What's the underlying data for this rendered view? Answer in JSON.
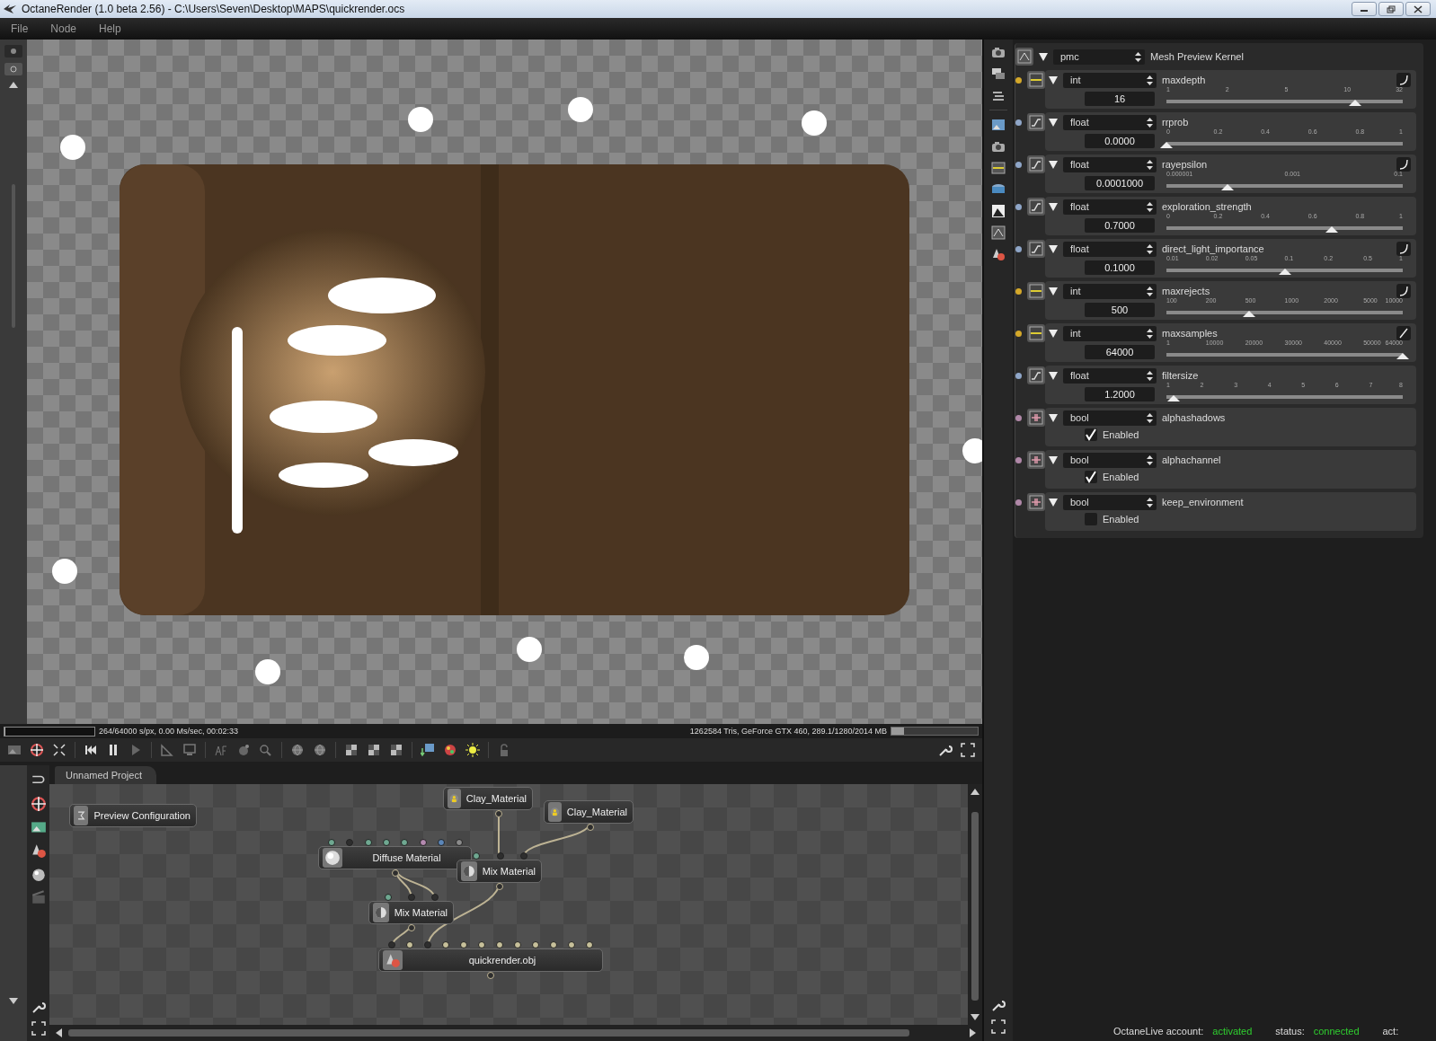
{
  "window": {
    "title": "OctaneRender (1.0 beta 2.56) - C:\\Users\\Seven\\Desktop\\MAPS\\quickrender.ocs"
  },
  "menu": [
    "File",
    "Node",
    "Help"
  ],
  "render_status": {
    "progress": {
      "level": 0.004
    },
    "stats": "264/64000 s/px, 0.00 Ms/sec, 00:02:33",
    "gpu_info": "1262584 Tris, GeForce GTX 460, 289.1/1280/2014 MB",
    "memory": {
      "level": 0.15
    }
  },
  "node_editor": {
    "tab": "Unnamed Project",
    "nodes": [
      {
        "kind": "config",
        "label": "Preview Configuration"
      },
      {
        "kind": "clay",
        "label": "Clay_Material"
      },
      {
        "kind": "clay",
        "label": "Clay_Material"
      },
      {
        "kind": "diffuse",
        "label": "Diffuse Material",
        "ports": [
          {
            "color": "#6fa891"
          },
          {
            "color": "#2e2e2e"
          },
          {
            "color": "#6fa891"
          },
          {
            "color": "#6fa891"
          },
          {
            "color": "#6fa891"
          },
          {
            "color": "#b48ab0"
          },
          {
            "color": "#5b86b8"
          },
          {
            "color": "#8a8a8a"
          }
        ]
      },
      {
        "kind": "mix",
        "label": "Mix Material",
        "ports": [
          {
            "color": "#6fa891"
          },
          {
            "color": "#2e2e2e"
          },
          {
            "color": "#2e2e2e"
          }
        ]
      },
      {
        "kind": "mix",
        "label": "Mix Material",
        "ports": [
          {
            "color": "#6fa891"
          },
          {
            "color": "#2e2e2e"
          },
          {
            "color": "#2e2e2e"
          }
        ]
      },
      {
        "kind": "mesh",
        "label": "quickrender.obj",
        "ports": [
          {
            "color": "#2e2e2e"
          },
          {
            "color": "#c7c09a"
          },
          {
            "color": "#2e2e2e"
          },
          {
            "color": "#c7c09a"
          },
          {
            "color": "#c7c09a"
          },
          {
            "color": "#c7c09a"
          },
          {
            "color": "#c7c09a"
          },
          {
            "color": "#c7c09a"
          },
          {
            "color": "#c7c09a"
          },
          {
            "color": "#c7c09a"
          },
          {
            "color": "#c7c09a"
          },
          {
            "color": "#c7c09a"
          }
        ]
      }
    ]
  },
  "kernel": {
    "select": "pmc",
    "title": "Mesh Preview Kernel",
    "params": [
      {
        "kind": "int",
        "type": "int",
        "name": "maxdepth",
        "value": "16",
        "ticks": [
          "1",
          "2",
          "5",
          "10",
          "32"
        ],
        "level": 0.8,
        "scale_button": {
          "kind": "curve"
        }
      },
      {
        "kind": "float",
        "type": "float",
        "name": "rrprob",
        "value": "0.0000",
        "ticks": [
          "0",
          "0.2",
          "0.4",
          "0.6",
          "0.8",
          "1"
        ],
        "level": 0
      },
      {
        "kind": "float",
        "type": "float",
        "name": "rayepsilon",
        "value": "0.0001000",
        "ticks": [
          "0.000001",
          "0.001",
          "0.1"
        ],
        "level": 0.26,
        "scale_button": {
          "kind": "curve"
        }
      },
      {
        "kind": "float",
        "type": "float",
        "name": "exploration_strength",
        "value": "0.7000",
        "ticks": [
          "0",
          "0.2",
          "0.4",
          "0.6",
          "0.8",
          "1"
        ],
        "level": 0.7
      },
      {
        "kind": "float",
        "type": "float",
        "name": "direct_light_importance",
        "value": "0.1000",
        "ticks": [
          "0.01",
          "0.02",
          "0.05",
          "0.1",
          "0.2",
          "0.5",
          "1"
        ],
        "level": 0.5,
        "scale_button": {
          "kind": "curve"
        }
      },
      {
        "kind": "int",
        "type": "int",
        "name": "maxrejects",
        "value": "500",
        "ticks": [
          "100",
          "200",
          "500",
          "1000",
          "2000",
          "5000",
          "10000"
        ],
        "level": 0.35,
        "scale_button": {
          "kind": "curve"
        }
      },
      {
        "kind": "int",
        "type": "int",
        "name": "maxsamples",
        "value": "64000",
        "ticks": [
          "1",
          "10000",
          "20000",
          "30000",
          "40000",
          "50000",
          "64000"
        ],
        "level": 1,
        "scale_button": {
          "kind": "line"
        }
      },
      {
        "kind": "float",
        "type": "float",
        "name": "filtersize",
        "value": "1.2000",
        "ticks": [
          "1",
          "2",
          "3",
          "4",
          "5",
          "6",
          "7",
          "8"
        ],
        "level": 0.03
      },
      {
        "kind": "bool",
        "type": "bool",
        "name": "alphashadows",
        "checked": true,
        "label": "Enabled"
      },
      {
        "kind": "bool",
        "type": "bool",
        "name": "alphachannel",
        "checked": true,
        "label": "Enabled"
      },
      {
        "kind": "bool",
        "type": "bool",
        "name": "keep_environment",
        "checked": false,
        "label": "Enabled"
      }
    ]
  },
  "status_bar": [
    {
      "label": "OctaneLive account:",
      "value": "activated"
    },
    {
      "label": "status:",
      "value": "connected"
    },
    {
      "label": "act:"
    }
  ]
}
